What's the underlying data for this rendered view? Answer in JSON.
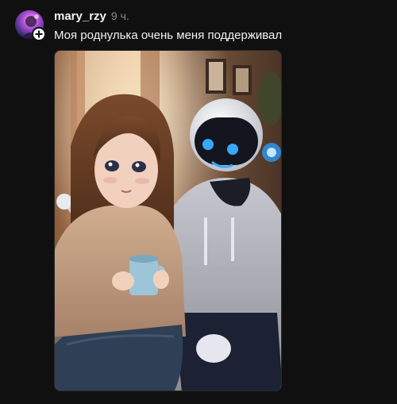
{
  "post": {
    "username": "mary_rzy",
    "time_ago": "9 ч.",
    "caption": "Моя роднулька очень меня поддерживал",
    "avatar_icon": "user-avatar",
    "follow_icon": "plus-icon",
    "image_description_colors": {
      "background_warm": "#6b4a34",
      "window_light": "#e8c9a6",
      "hoodie": "#a9a9b1",
      "sweater": "#c09a7c",
      "robot_head": "#e9eaee",
      "robot_visor": "#14161f",
      "robot_eyes": "#37a8ff"
    }
  }
}
